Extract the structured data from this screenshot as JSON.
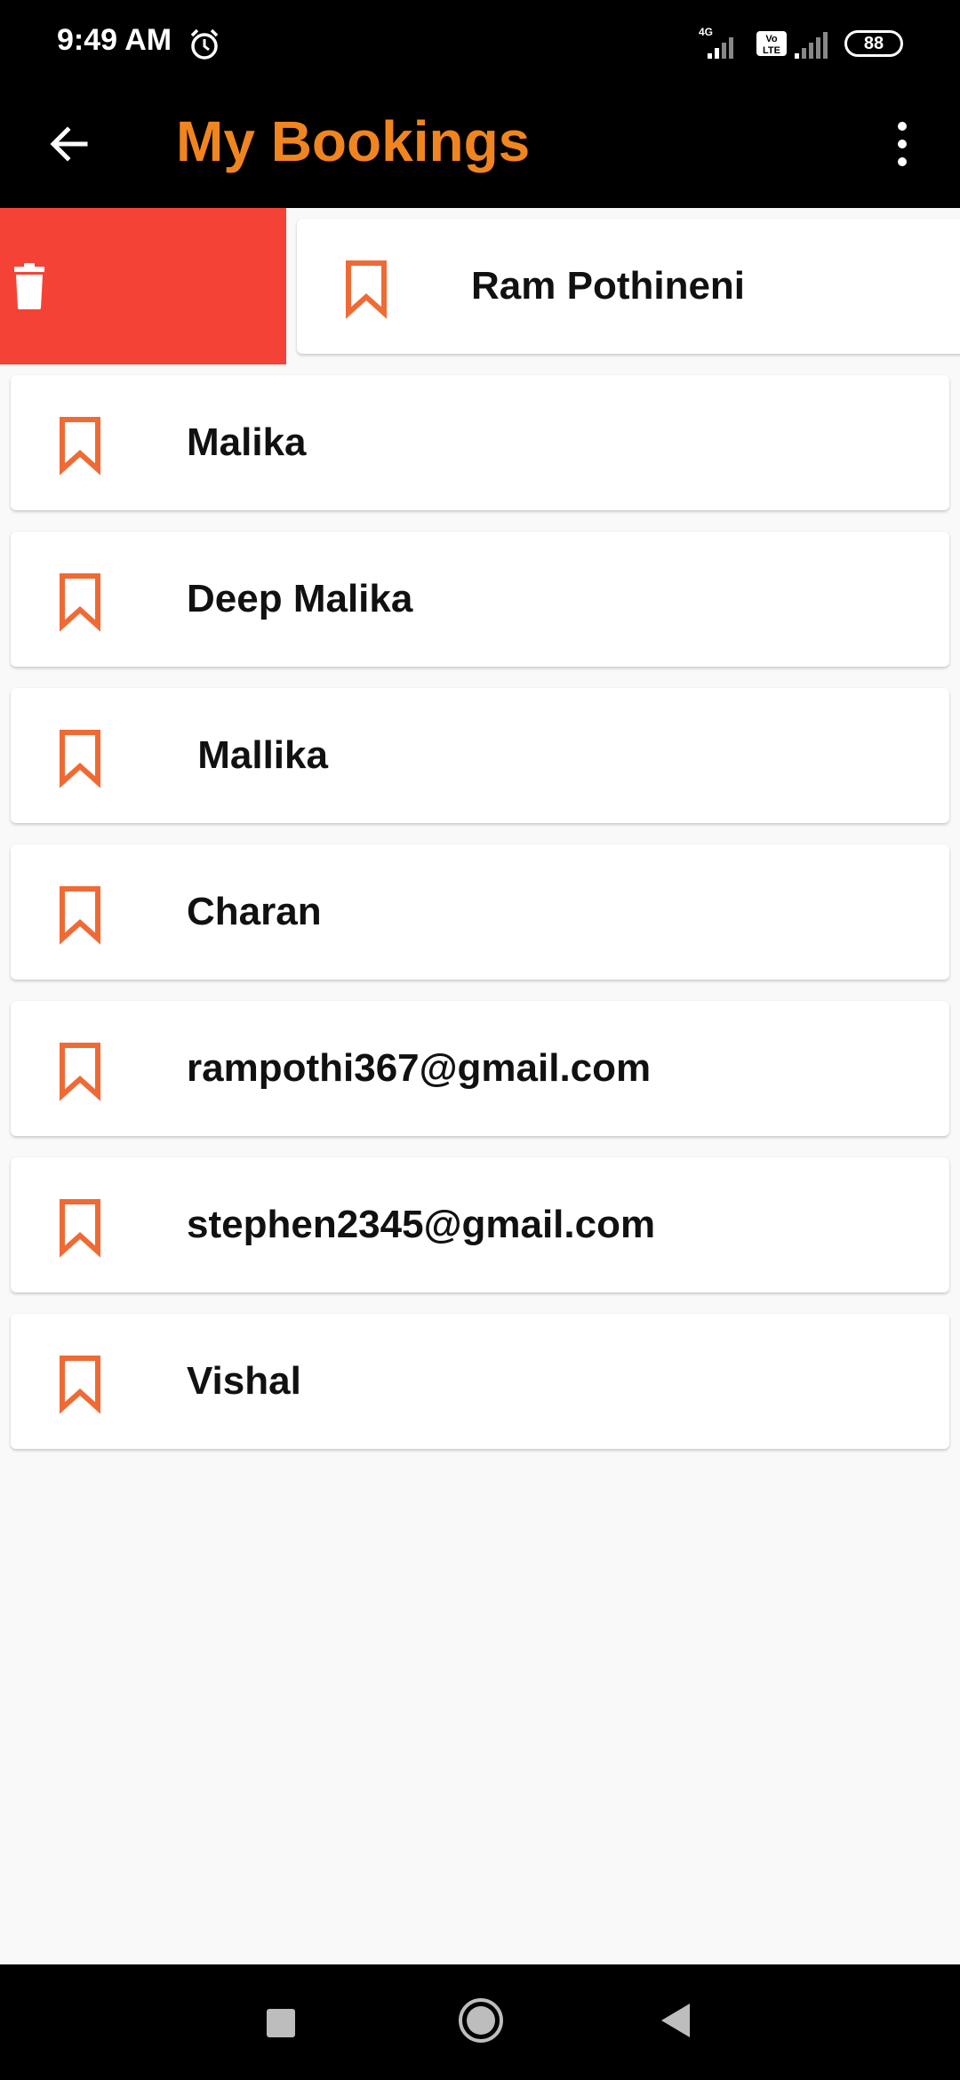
{
  "status_bar": {
    "time": "9:49 AM",
    "network_type": "4G",
    "volte_label": "Vo LTE",
    "battery": "88"
  },
  "app_bar": {
    "title": "My Bookings",
    "back_icon": "arrow-left-icon",
    "menu_icon": "more-vert-icon"
  },
  "swiped_item": {
    "name": "Ram Pothineni",
    "action_icon": "trash-icon",
    "action_color": "#f44336"
  },
  "bookings": [
    {
      "name": "Malika"
    },
    {
      "name": "Deep Malika"
    },
    {
      "name": " Mallika"
    },
    {
      "name": "Charan"
    },
    {
      "name": "rampothi367@gmail.com"
    },
    {
      "name": "stephen2345@gmail.com"
    },
    {
      "name": "Vishal"
    }
  ],
  "colors": {
    "accent": "#f0851f",
    "bookmark": "#f06a35",
    "app_bar_bg": "#000000",
    "page_bg": "#f9f9f9"
  },
  "nav_bar": {
    "icons": [
      "recents-square-icon",
      "home-circle-icon",
      "back-triangle-icon"
    ]
  }
}
